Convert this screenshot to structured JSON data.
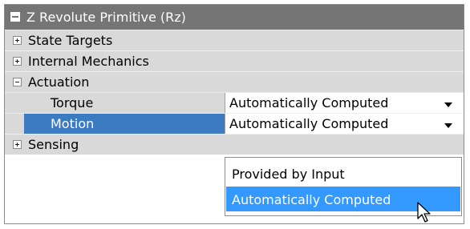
{
  "panel": {
    "title": "Z Revolute Primitive (Rz)",
    "groups": [
      {
        "label": "State Targets",
        "expanded": false
      },
      {
        "label": "Internal Mechanics",
        "expanded": false
      },
      {
        "label": "Actuation",
        "expanded": true
      },
      {
        "label": "Sensing",
        "expanded": false
      }
    ],
    "properties": [
      {
        "name": "Torque",
        "value": "Automatically Computed"
      },
      {
        "name": "Motion",
        "value": "Automatically Computed",
        "selected": true
      }
    ]
  },
  "dropdown": {
    "options": [
      "Provided by Input",
      "Automatically Computed"
    ],
    "highlighted_index": 1
  },
  "colors": {
    "header_bg": "#757575",
    "row_bg": "#d9d9d9",
    "selected_row": "#3c7ac2",
    "dropdown_highlight": "#3399ff"
  }
}
